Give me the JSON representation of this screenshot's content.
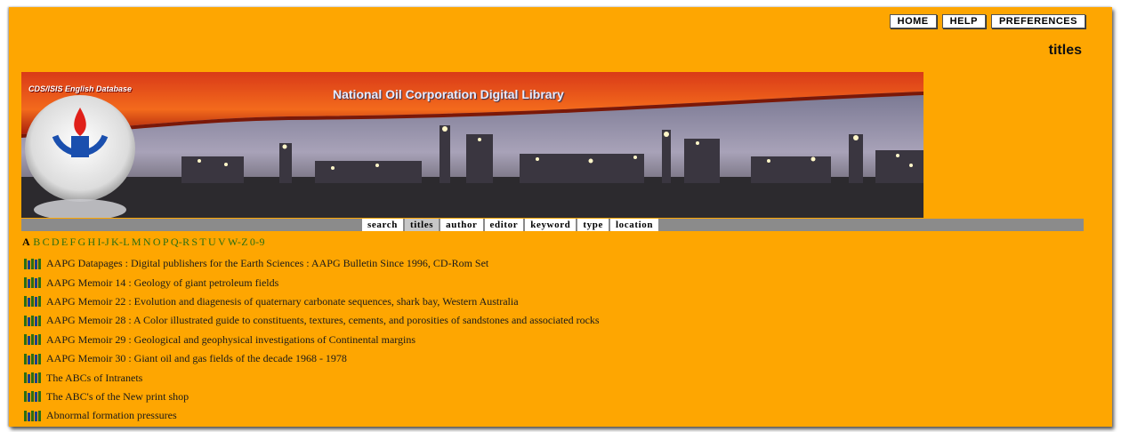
{
  "topnav": {
    "home": "HOME",
    "help": "HELP",
    "preferences": "PREFERENCES"
  },
  "page_title": "titles",
  "banner": {
    "tag": "CDS/ISIS English Database",
    "title": "National Oil Corporation Digital Library"
  },
  "tabs": [
    {
      "label": "search"
    },
    {
      "label": "titles",
      "active": true
    },
    {
      "label": "author"
    },
    {
      "label": "editor"
    },
    {
      "label": "keyword"
    },
    {
      "label": "type"
    },
    {
      "label": "location"
    }
  ],
  "alphabet": {
    "current": "A",
    "links": [
      "B",
      "C",
      "D",
      "E",
      "F",
      "G",
      "H",
      "I-J",
      "K-L",
      "M",
      "N",
      "O",
      "P",
      "Q-R",
      "S",
      "T",
      "U",
      "V",
      "W-Z",
      "0-9"
    ]
  },
  "results": [
    "AAPG Datapages : Digital publishers for the Earth Sciences : AAPG Bulletin Since 1996, CD-Rom Set",
    "AAPG Memoir 14 : Geology of giant petroleum fields",
    "AAPG Memoir 22 : Evolution and diagenesis of quaternary carbonate sequences, shark bay, Western Australia",
    "AAPG Memoir 28 : A Color illustrated guide to constituents, textures, cements, and porosities of sandstones and associated rocks",
    "AAPG Memoir 29 : Geological and geophysical investigations of Continental margins",
    "AAPG Memoir 30 : Giant oil and gas fields of the decade 1968 - 1978",
    "The ABCs of Intranets",
    "The ABC's of the New print shop",
    "Abnormal formation pressures"
  ],
  "colors": {
    "page_bg": "#fea601",
    "tab_bar": "#8b8b8b",
    "link_green": "#2a6e12"
  },
  "icons": {
    "result_icon": "books-icon"
  }
}
